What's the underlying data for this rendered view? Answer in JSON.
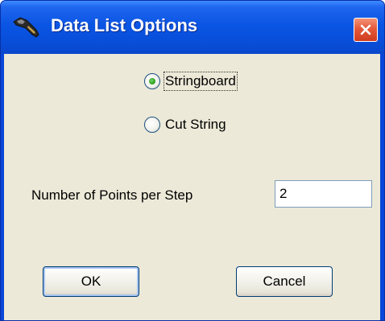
{
  "window": {
    "title": "Data List Options",
    "app_icon": "wrench-icon",
    "close_icon": "close-icon"
  },
  "options": {
    "items": [
      {
        "label": "Stringboard",
        "selected": true
      },
      {
        "label": "Cut String",
        "selected": false
      }
    ]
  },
  "points": {
    "label": "Number of Points per Step",
    "value": "2"
  },
  "buttons": {
    "ok_label": "OK",
    "cancel_label": "Cancel"
  },
  "colors": {
    "titlebar": "#0b55e4",
    "close_button": "#e4593a",
    "client_background": "#ece9d8",
    "radio_selected": "#2fa21f"
  }
}
